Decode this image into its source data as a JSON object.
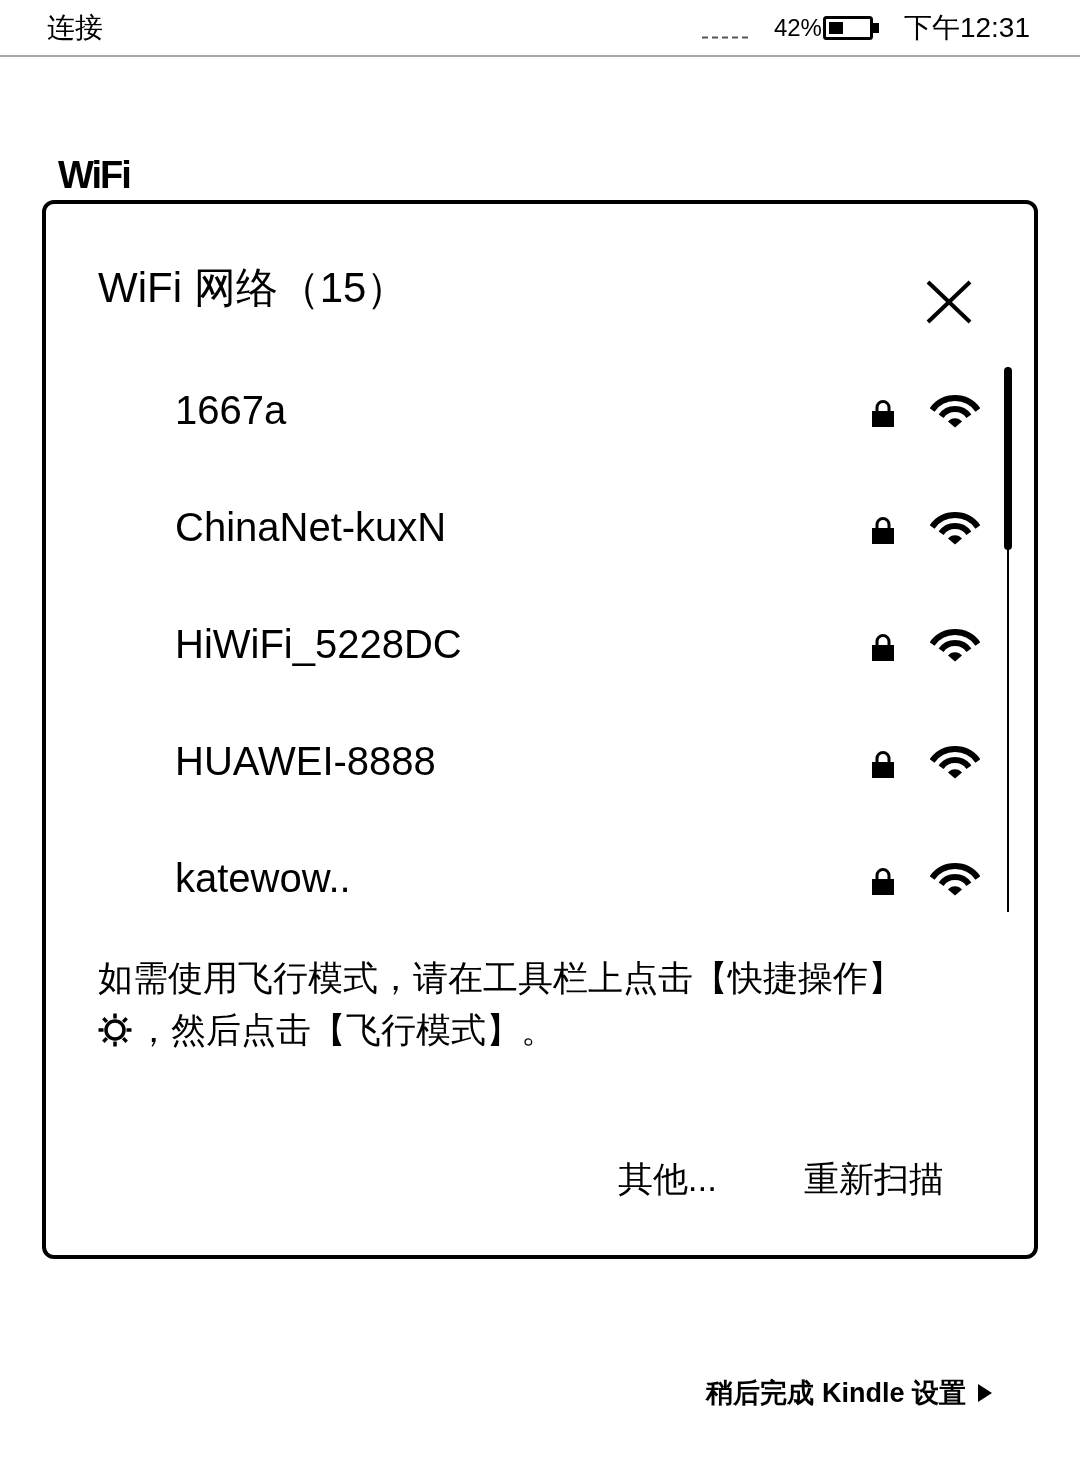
{
  "status_bar": {
    "title": "连接",
    "battery_text": "42%",
    "time": "下午12:31"
  },
  "page": {
    "heading": "WiFi"
  },
  "dialog": {
    "title": "WiFi 网络（15）",
    "networks": [
      {
        "name": "1667a",
        "secured": true
      },
      {
        "name": "ChinaNet-kuxN",
        "secured": true
      },
      {
        "name": "HiWiFi_5228DC",
        "secured": true
      },
      {
        "name": "HUAWEI-8888",
        "secured": true
      },
      {
        "name": "katewow..",
        "secured": true
      }
    ],
    "hint": {
      "before_icon": "如需使用飞行模式，请在工具栏上点击【快捷操作】",
      "after_icon": "，然后点击【飞行模式】。"
    },
    "buttons": [
      "其他...",
      "重新扫描"
    ]
  },
  "footer_link": {
    "label": "稍后完成 Kindle 设置"
  }
}
